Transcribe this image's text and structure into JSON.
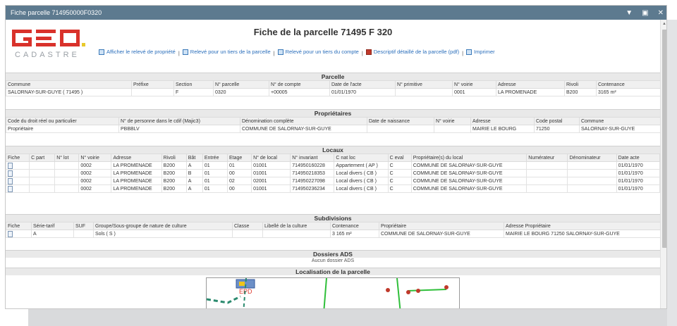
{
  "window": {
    "title": "Fiche parcelle 714950000F0320"
  },
  "logo": {
    "main": "GEO",
    "sub": "CADASTRE"
  },
  "heading": "Fiche de la parcelle 71495 F 320",
  "links": [
    "Afficher le relevé de propriété",
    "Relevé pour un tiers de la parcelle",
    "Relevé pour un tiers du compte",
    "Descriptif détaillé de la parcelle (pdf)",
    "Imprimer"
  ],
  "link_sep": "|",
  "parcelle": {
    "title": "Parcelle",
    "headers": [
      "Commune",
      "Préfixe",
      "Section",
      "N° parcelle",
      "N° de compte",
      "Date de l'acte",
      "N° primitive",
      "N° voirie",
      "Adresse",
      "Rivoli",
      "Contenance"
    ],
    "rows": [
      [
        "SALORNAY-SUR-GUYE ( 71495 )",
        "",
        "F",
        "0320",
        "+00005",
        "01/01/1970",
        "",
        "0001",
        "LA PROMENADE",
        "B200",
        "3165 m²"
      ]
    ]
  },
  "proprietaires": {
    "title": "Propriétaires",
    "headers": [
      "Code du droit réel ou particulier",
      "N° de personne dans le cdif (Majic3)",
      "Dénomination complète",
      "Date de naissance",
      "N° voirie",
      "Adresse",
      "Code postal",
      "Commune"
    ],
    "rows": [
      [
        "Propriétaire",
        "PBBBLV",
        "COMMUNE DE SALORNAY-SUR-GUYE",
        "",
        "",
        "MAIRIE LE BOURG",
        "71250",
        "SALORNAY-SUR-GUYE"
      ]
    ]
  },
  "locaux": {
    "title": "Locaux",
    "headers": [
      "Fiche",
      "C part",
      "N° lot",
      "N° voirie",
      "Adresse",
      "Rivoli",
      "Bât",
      "Entrée",
      "Etage",
      "N° de local",
      "N° invariant",
      "C nat loc",
      "C eval",
      "Propriétaire(s) du local",
      "Numérateur",
      "Dénominateur",
      "Date acte"
    ],
    "rows": [
      [
        "",
        "",
        "",
        "0002",
        "LA PROMENADE",
        "B200",
        "A",
        "01",
        "01",
        "01001",
        "714950160228",
        "Appartement ( AP )",
        "C",
        "COMMUNE DE SALORNAY-SUR-GUYE",
        "",
        "",
        "01/01/1970"
      ],
      [
        "",
        "",
        "",
        "0002",
        "LA PROMENADE",
        "B200",
        "B",
        "01",
        "00",
        "01001",
        "714950218353",
        "Local divers ( CB )",
        "C",
        "COMMUNE DE SALORNAY-SUR-GUYE",
        "",
        "",
        "01/01/1970"
      ],
      [
        "",
        "",
        "",
        "0002",
        "LA PROMENADE",
        "B200",
        "A",
        "01",
        "02",
        "02001",
        "714950227098",
        "Local divers ( CB )",
        "C",
        "COMMUNE DE SALORNAY-SUR-GUYE",
        "",
        "",
        "01/01/1970"
      ],
      [
        "",
        "",
        "",
        "0002",
        "LA PROMENADE",
        "B200",
        "A",
        "01",
        "00",
        "01001",
        "714950236234",
        "Local divers ( CB )",
        "C",
        "COMMUNE DE SALORNAY-SUR-GUYE",
        "",
        "",
        "01/01/1970"
      ]
    ]
  },
  "subdivisions": {
    "title": "Subdivisions",
    "headers": [
      "Fiche",
      "Série-tarif",
      "SUF",
      "Groupe/Sous-groupe de nature de culture",
      "Classe",
      "Libellé de la culture",
      "Contenance",
      "Propriétaire",
      "Adresse Propriétaire"
    ],
    "rows": [
      [
        "",
        "A",
        "",
        "Sols ( S )",
        "",
        "",
        "3 165 m²",
        "COMMUNE DE SALORNAY-SUR-GUYE",
        "MAIRIE LE BOURG 71250 SALORNAY-SUR-GUYE"
      ]
    ]
  },
  "ads": {
    "title": "Dossiers ADS",
    "text": "Aucun dossier ADS"
  },
  "localisation": {
    "title": "Localisation de la parcelle",
    "map_label": "EPD"
  },
  "colors": {
    "titlebar": "#5d7a8f",
    "logo_red": "#d9322b",
    "link": "#2a6ebb",
    "map_green": "#2fbf3a"
  }
}
